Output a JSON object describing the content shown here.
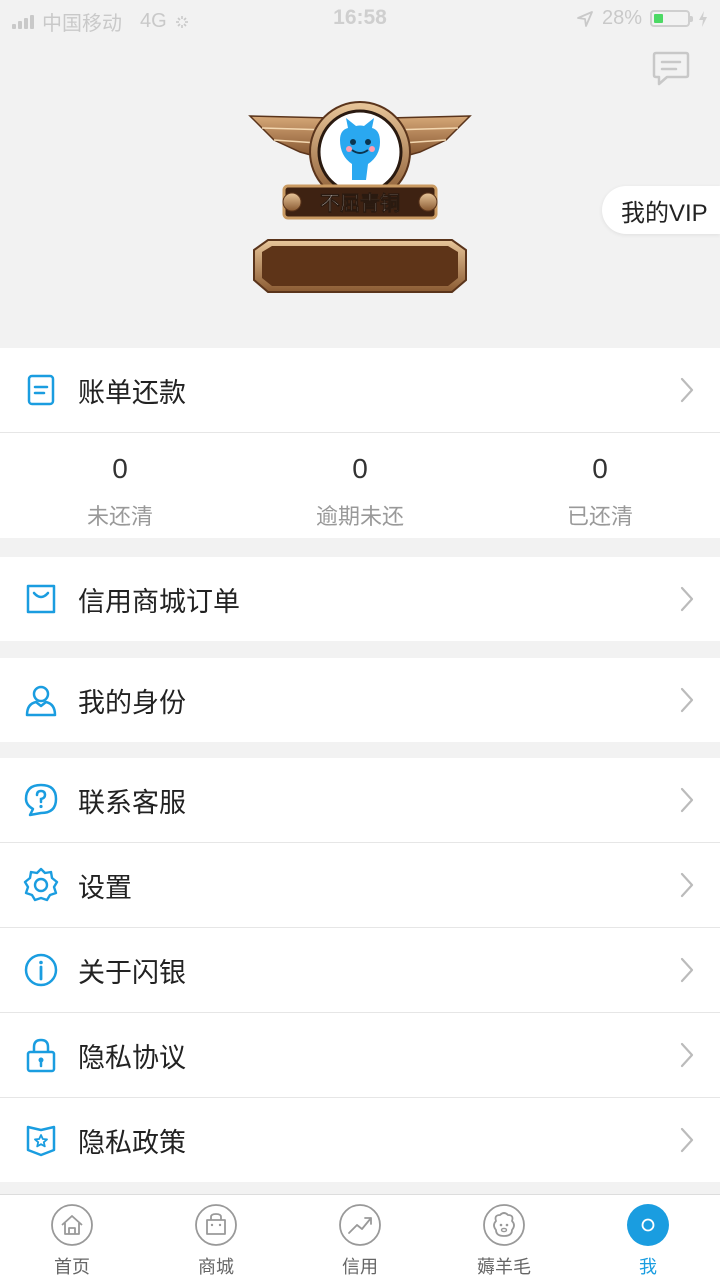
{
  "status_bar": {
    "carrier": "中国移动",
    "network": "4G",
    "time": "16:58",
    "battery": "28%"
  },
  "header": {
    "vip_label": "我的VIP",
    "badge_text": "不屈青铜"
  },
  "bill": {
    "label": "账单还款",
    "stats": [
      {
        "value": "0",
        "caption": "未还清"
      },
      {
        "value": "0",
        "caption": "逾期未还"
      },
      {
        "value": "0",
        "caption": "已还清"
      }
    ]
  },
  "orders": {
    "label": "信用商城订单"
  },
  "identity": {
    "label": "我的身份"
  },
  "menu": [
    {
      "label": "联系客服",
      "icon": "question-bubble-icon"
    },
    {
      "label": "设置",
      "icon": "gear-icon"
    },
    {
      "label": "关于闪银",
      "icon": "info-icon"
    },
    {
      "label": "隐私协议",
      "icon": "lock-icon"
    },
    {
      "label": "隐私政策",
      "icon": "shield-star-icon"
    }
  ],
  "tabs": [
    {
      "label": "首页",
      "icon": "home-icon"
    },
    {
      "label": "商城",
      "icon": "bag-icon"
    },
    {
      "label": "信用",
      "icon": "trend-icon"
    },
    {
      "label": "薅羊毛",
      "icon": "sheep-icon"
    },
    {
      "label": "我",
      "icon": "me-icon",
      "active": true
    }
  ],
  "colors": {
    "accent": "#1a9de0",
    "badge_brown": "#6b3a1f",
    "badge_gold": "#c99a62"
  }
}
